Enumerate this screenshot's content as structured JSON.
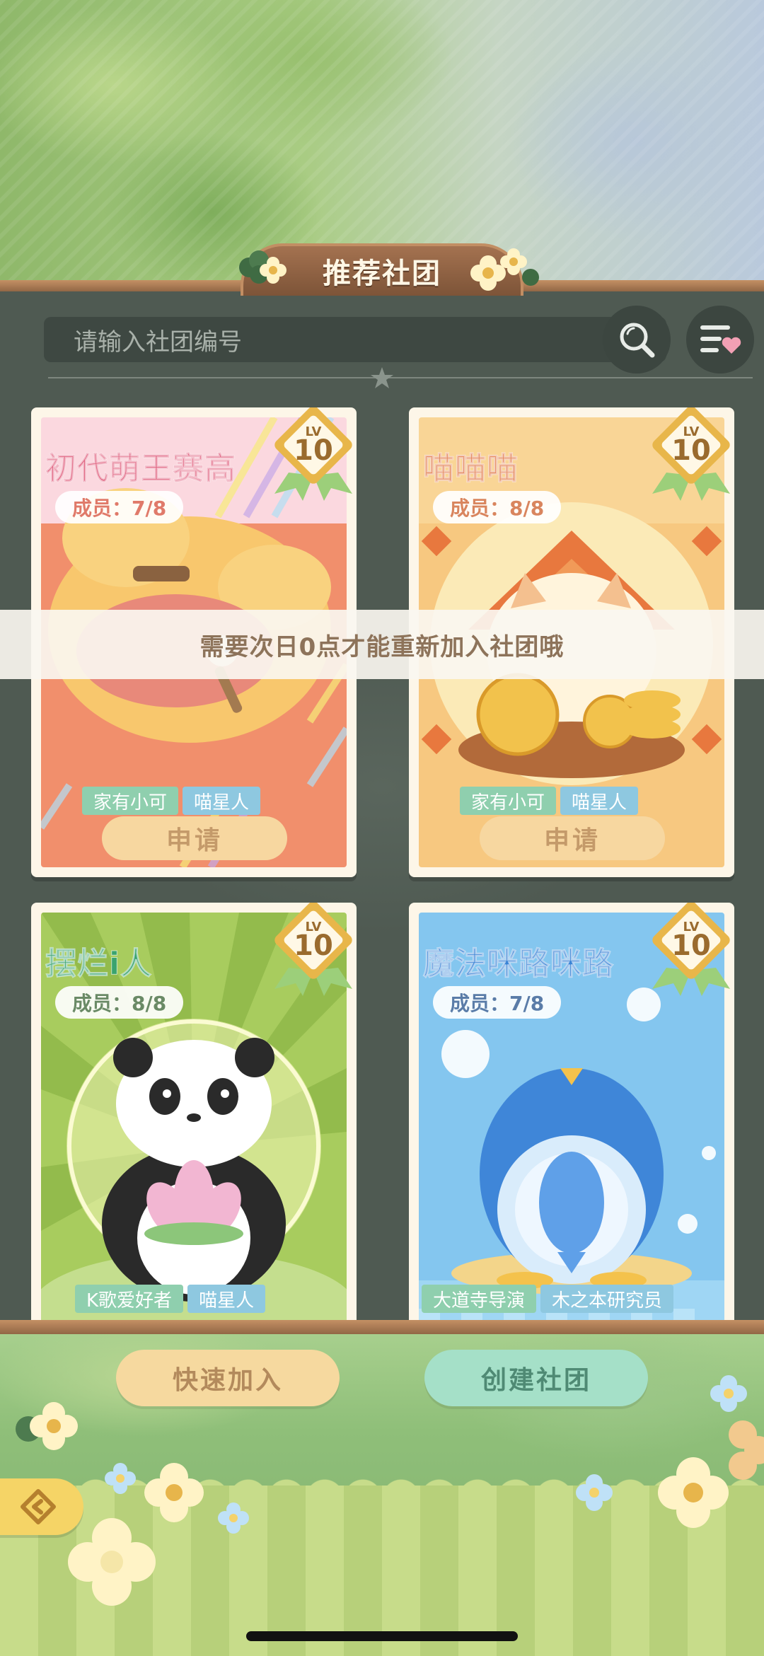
{
  "header": {
    "title": "推荐社团"
  },
  "search": {
    "placeholder": "请输入社团编号"
  },
  "icons": {
    "search": "magnifier-icon",
    "filter": "filter-heart-icon",
    "back": "back-arrow-icon",
    "divider": "star-icon"
  },
  "clubs": [
    {
      "name": "初代萌王赛高",
      "members_label": "成员：7/8",
      "level_prefix": "LV",
      "level": "10",
      "tags": [
        "家有小可",
        "喵星人"
      ],
      "apply_label": "申请",
      "name_color": "#e0607e",
      "members_color": "#e07a6a"
    },
    {
      "name": "喵喵喵",
      "members_label": "成员：8/8",
      "level_prefix": "LV",
      "level": "10",
      "tags": [
        "家有小可",
        "喵星人"
      ],
      "apply_label": "申请",
      "name_color": "#e27846",
      "members_color": "#d9855e"
    },
    {
      "name": "摆烂i人",
      "members_label": "成员：8/8",
      "level_prefix": "LV",
      "level": "10",
      "tags": [
        "K歌爱好者",
        "喵星人"
      ],
      "name_color": "#3aa36e",
      "members_color": "#6a8a66"
    },
    {
      "name": "魔法咪路咪路",
      "members_label": "成员：7/8",
      "level_prefix": "LV",
      "level": "10",
      "tags": [
        "大道寺导演",
        "木之本研究员"
      ],
      "name_color": "#3a84d6",
      "members_color": "#5a7ca8"
    }
  ],
  "toast": {
    "message": "需要次日0点才能重新加入社团哦"
  },
  "actions": {
    "quick_join": "快速加入",
    "create_club": "创建社团"
  },
  "colors": {
    "board": "#4f5a52",
    "wood": "#8c6242",
    "quick_join_bg": "#f6d99f",
    "create_bg": "#a5e0c8",
    "badge_gold": "#e8b64a"
  }
}
